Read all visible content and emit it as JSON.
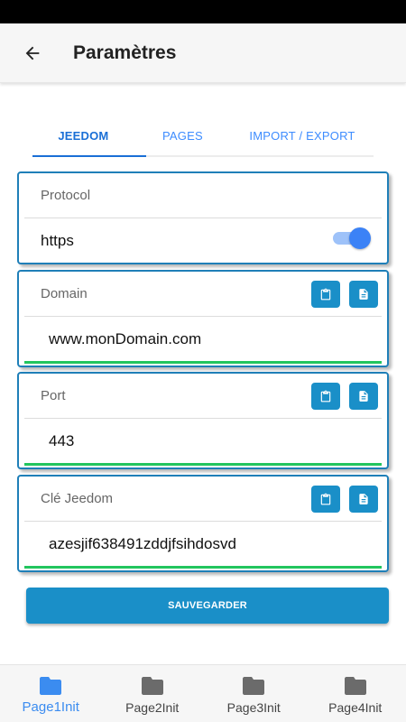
{
  "app_bar": {
    "title": "Paramètres",
    "back_icon": "arrow-left-icon"
  },
  "tabs": [
    {
      "label": "JEEDOM",
      "active": true
    },
    {
      "label": "PAGES",
      "active": false
    },
    {
      "label": "IMPORT / EXPORT",
      "active": false
    }
  ],
  "protocol": {
    "label": "Protocol",
    "value": "https",
    "toggle_on": true
  },
  "domain": {
    "label": "Domain",
    "value": "www.monDomain.com",
    "actions": [
      "clipboard-paste-icon",
      "file-copy-icon"
    ]
  },
  "port": {
    "label": "Port",
    "value": "443",
    "actions": [
      "clipboard-paste-icon",
      "file-copy-icon"
    ]
  },
  "key": {
    "label": "Clé Jeedom",
    "value": "azesjif638491zddjfsihdosvd",
    "actions": [
      "clipboard-paste-icon",
      "file-copy-icon"
    ]
  },
  "save_button": {
    "label": "SAUVEGARDER"
  },
  "bottom_nav": [
    {
      "label": "Page1Init",
      "active": true,
      "icon": "folder-icon"
    },
    {
      "label": "Page2Init",
      "active": false,
      "icon": "folder-icon"
    },
    {
      "label": "Page3Init",
      "active": false,
      "icon": "folder-icon"
    },
    {
      "label": "Page4Init",
      "active": false,
      "icon": "folder-icon"
    }
  ],
  "colors": {
    "accent": "#1a8fc8",
    "tab_active": "#1a6fd6",
    "valid_line": "#22c55e",
    "nav_active": "#3b8cf0"
  }
}
